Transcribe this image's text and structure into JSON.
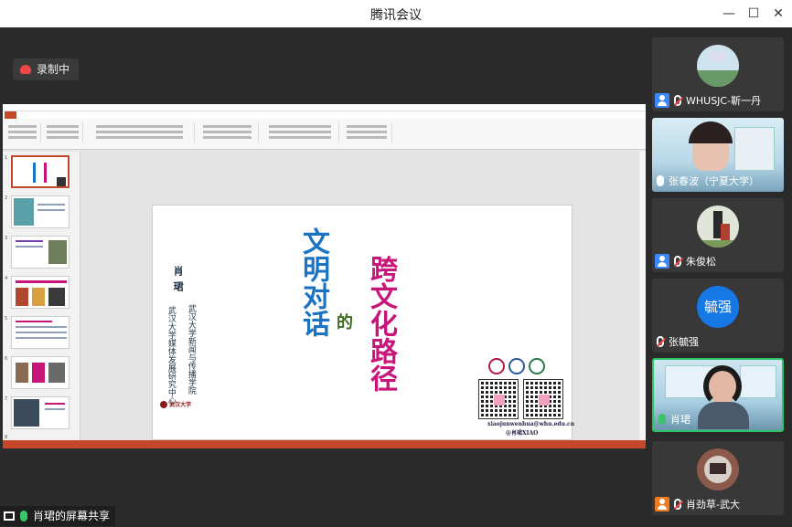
{
  "window": {
    "title": "腾讯会议",
    "minimize": "—",
    "maximize": "☐",
    "close": "✕"
  },
  "recording": {
    "label": "录制中"
  },
  "screen_share": {
    "label": "肖珺的屏幕共享"
  },
  "slide": {
    "title_left": "文明对话",
    "connector": "的",
    "title_right": "跨文化路径",
    "author": "肖珺",
    "affiliation_1": "武汉大学新闻与传播学院",
    "affiliation_2": "武汉大学媒体发展研究中心",
    "email": "xiaojunwenhua@whu.edu.cn",
    "handle": "@肖珺XIAO",
    "university_logo_text": "武汉大学"
  },
  "participants": [
    {
      "name": "WHUSJC-靳一丹",
      "kind": "avatar",
      "avatar_bg": "#cfe3ee",
      "icon_color": "#3a86ff",
      "mic": "off"
    },
    {
      "name": "张春波（宁夏大学）",
      "kind": "video",
      "mic": "on"
    },
    {
      "name": "朱俊松",
      "kind": "avatar",
      "avatar_bg": "#dfe6d8",
      "icon_color": "#3a86ff",
      "mic": "off"
    },
    {
      "name": "张毓强",
      "kind": "initials",
      "initials": "毓强",
      "mic": "off"
    },
    {
      "name": "肖珺",
      "kind": "video",
      "mic": "active",
      "speaking": true
    },
    {
      "name": "肖劲草-武大",
      "kind": "avatar",
      "avatar_bg": "#8b5a4a",
      "icon_color": "#f07b1f",
      "mic": "off"
    }
  ],
  "colors": {
    "accent_green": "#2bc467",
    "ppt_red": "#c4472a",
    "title_blue": "#1b73c4",
    "title_pink": "#c8157a"
  }
}
